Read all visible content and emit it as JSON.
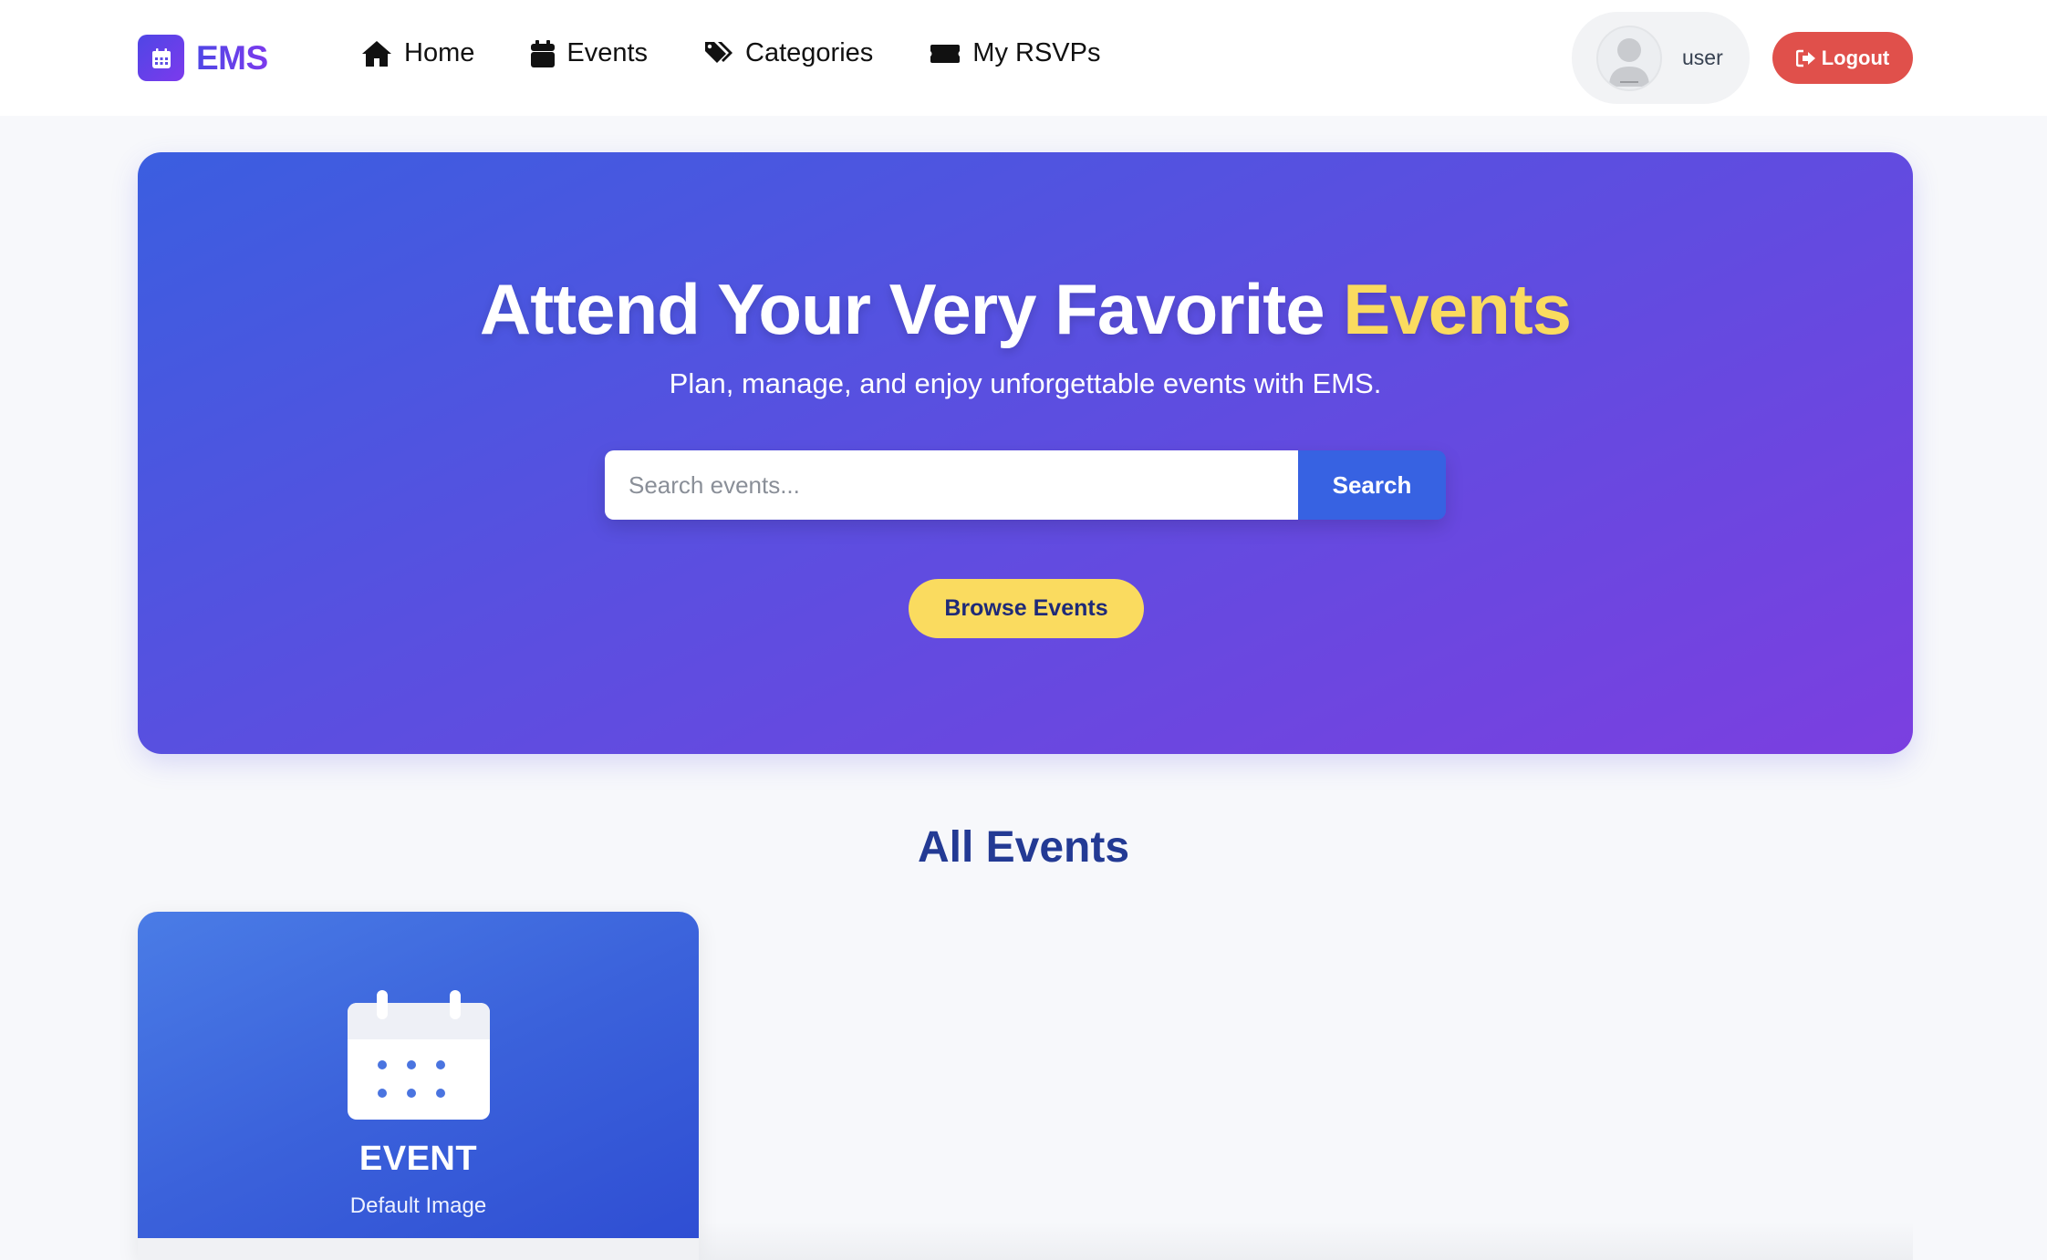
{
  "brand": {
    "name": "EMS",
    "icon": "calendar-icon",
    "gradient": [
      "#4f46e5",
      "#7c3aed"
    ]
  },
  "nav": {
    "items": [
      {
        "label": "Home",
        "icon": "home-icon"
      },
      {
        "label": "Events",
        "icon": "calendar-icon"
      },
      {
        "label": "Categories",
        "icon": "tags-icon"
      },
      {
        "label": "My RSVPs",
        "icon": "ticket-icon"
      }
    ]
  },
  "user": {
    "name": "user",
    "avatar_icon": "user-avatar-icon"
  },
  "logout": {
    "label": "Logout",
    "icon": "logout-icon",
    "color": "#e0504b"
  },
  "hero": {
    "title_main": "Attend Your Very Favorite ",
    "title_accent": "Events",
    "subtitle": "Plan, manage, and enjoy unforgettable events with EMS.",
    "search": {
      "placeholder": "Search events...",
      "value": "",
      "button_label": "Search"
    },
    "browse_label": "Browse Events",
    "accent_color": "#fadb5f"
  },
  "events_section": {
    "title": "All Events",
    "cards": [
      {
        "title": "EVENT",
        "subtitle": "Default Image",
        "icon": "calendar-icon"
      }
    ]
  }
}
